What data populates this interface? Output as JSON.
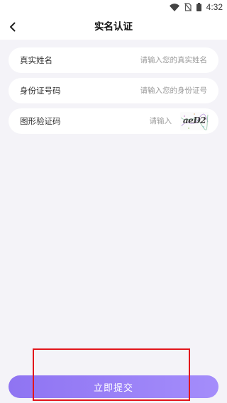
{
  "status_bar": {
    "time": "4:32",
    "icons": [
      "wifi-icon",
      "no-sim-icon",
      "battery-icon"
    ]
  },
  "header": {
    "title": "实名认证",
    "back_icon": "chevron-left-icon"
  },
  "form": {
    "name": {
      "label": "真实姓名",
      "placeholder": "请输入您的真实姓名",
      "value": ""
    },
    "id_number": {
      "label": "身份证号码",
      "placeholder": "请输入您的身份证号",
      "value": ""
    },
    "captcha": {
      "label": "图形验证码",
      "placeholder": "请输入",
      "value": "",
      "image_text": "aeD2"
    }
  },
  "submit": {
    "label": "立即提交"
  },
  "colors": {
    "background": "#f4f3f8",
    "button_gradient_start": "#8f74f2",
    "button_gradient_end": "#a48dfb",
    "highlight_border": "#e2161c"
  }
}
